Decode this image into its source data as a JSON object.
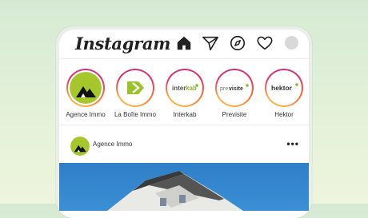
{
  "app": {
    "title": "Instagram"
  },
  "nav_icons": [
    "home-icon",
    "direct-message-icon",
    "explore-compass-icon",
    "activity-heart-icon",
    "profile-avatar"
  ],
  "stories": [
    {
      "name": "Agence Immo",
      "logo": ""
    },
    {
      "name": "La Boîte Immo",
      "logo": ""
    },
    {
      "name": "Interkab",
      "logo": "interkab"
    },
    {
      "name": "Previsite",
      "logo": "previsite"
    },
    {
      "name": "Hektor",
      "logo": "hektor"
    }
  ],
  "post": {
    "username": "Agence Immo",
    "more_label": "•••"
  },
  "colors": {
    "accent_green": "#a6c72b",
    "ring_pink": "#c13584",
    "ring_orange": "#fcaf45",
    "sky": "#3b8fd4"
  }
}
